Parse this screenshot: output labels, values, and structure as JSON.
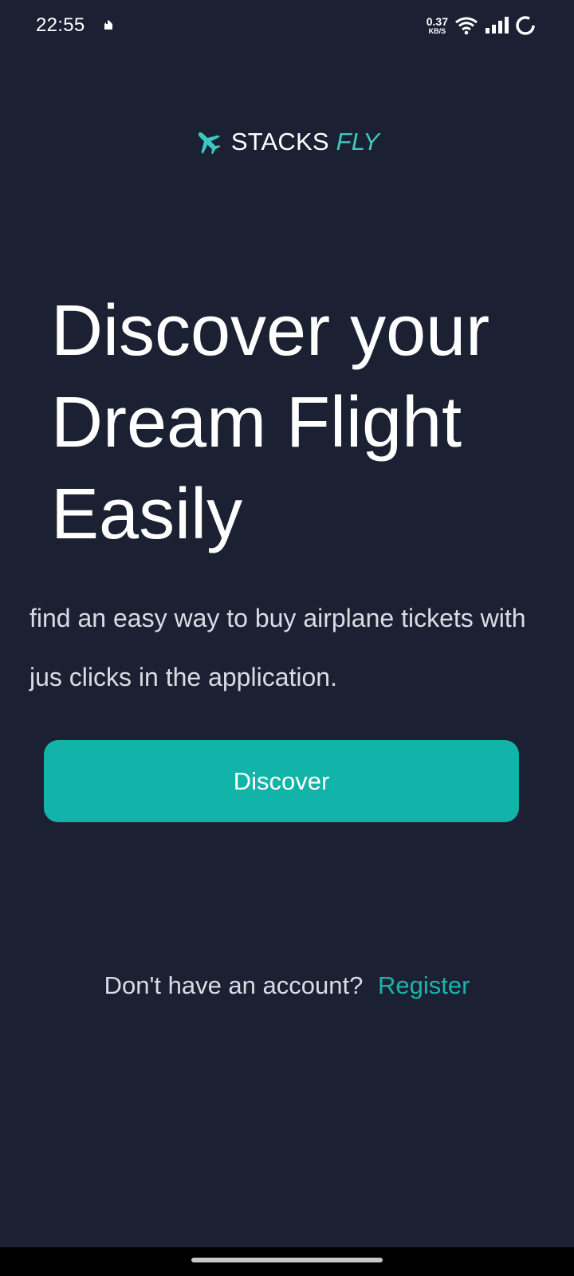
{
  "status_bar": {
    "time": "22:55",
    "net_speed_value": "0.37",
    "net_speed_unit": "KB/S",
    "icons": [
      "notification-icon",
      "wifi-icon",
      "signal-icon",
      "battery-icon"
    ]
  },
  "logo": {
    "icon": "airplane-icon",
    "text_main": "STACKS",
    "text_accent": "FLY",
    "accent_color": "#3cc8c0"
  },
  "hero": {
    "headline_line1": "Discover your",
    "headline_line2": "Dream Flight",
    "headline_line3": "Easily",
    "subtext": "find an easy way to buy airplane tickets with jus clicks in the application."
  },
  "actions": {
    "discover_label": "Discover",
    "button_color": "#12b3a8"
  },
  "footer": {
    "prompt": "Don't have an account?",
    "register_label": "Register"
  },
  "colors": {
    "background": "#1b2133",
    "text": "#ffffff",
    "muted_text": "#d9dce3"
  }
}
